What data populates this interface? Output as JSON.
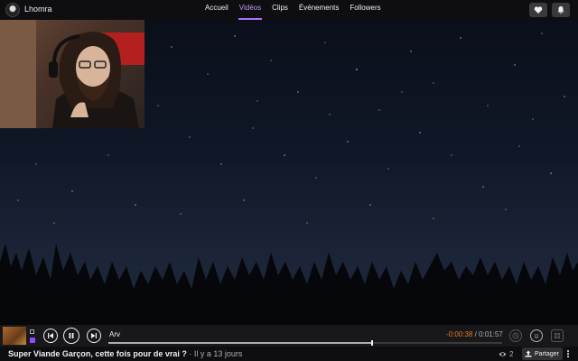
{
  "header": {
    "channel_name": "Lhomra",
    "nav": [
      {
        "label": "Accueil",
        "active": false
      },
      {
        "label": "Vidéos",
        "active": true
      },
      {
        "label": "Clips",
        "active": false
      },
      {
        "label": "Événements",
        "active": false
      },
      {
        "label": "Followers",
        "active": false
      }
    ],
    "buttons": [
      "heart-icon",
      "bell-icon"
    ]
  },
  "player": {
    "track_label": "Arv",
    "time_remaining": "-0:00:38",
    "time_separator": " / ",
    "time_total": "0:01:57",
    "progress": 0.67,
    "controls": [
      "previous-icon",
      "pause-icon",
      "next-icon"
    ],
    "right_controls": [
      "clock-icon",
      "emote-icon",
      "grid-icon"
    ]
  },
  "video_info": {
    "title": "Super Viande Garçon, cette fois pour de vrai ?",
    "meta": " · Il y a 13 jours",
    "viewers": "2",
    "share_label": "Partager"
  },
  "colors": {
    "accent": "#a970ff",
    "accent_text": "#bf94ff",
    "time_negative": "#e87722",
    "background": "#0e0e10"
  }
}
